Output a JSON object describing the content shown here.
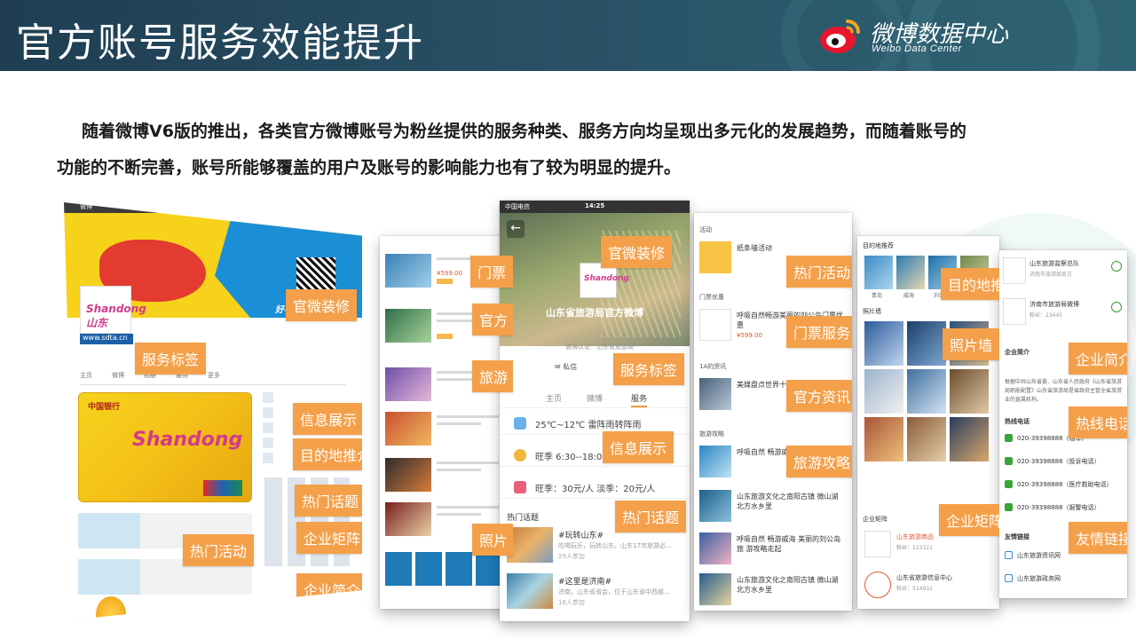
{
  "header": {
    "title": "官方账号服务效能提升",
    "brand_name": "微博数据中心",
    "brand_sub": "Weibo Data Center"
  },
  "intro": {
    "line1": "随着微博V6版的推出，各类官方微博账号为粉丝提供的服务种类、服务方向均呈现出多元化的发展趋势，而随着账号的",
    "line2": "功能的不断完善，账号所能够覆盖的用户及账号的影响能力也有了较为明显的提升。"
  },
  "colors": {
    "tag": "#f4a04a",
    "header": "#1f3e52"
  },
  "panel1": {
    "tags": [
      "官微装修",
      "服务标签",
      "信息展示",
      "目的地推介",
      "热门话题",
      "企业矩阵",
      "企业简介",
      "热门活动"
    ],
    "url": "www.sdta.cn",
    "slogan": "好客山东欢迎您",
    "logo": "Shandong 山东",
    "card_bank": "中国银行",
    "card_name": "Shandong"
  },
  "panel2": {
    "tags": [
      "门票",
      "官方",
      "旅游",
      "照片"
    ],
    "price": "¥599.00"
  },
  "panel3": {
    "carrier": "中国电信",
    "time": "14:25",
    "account_name": "山东省旅游局官方微博",
    "verify": "微博认证：山东省旅游局",
    "msg": "私信",
    "tabs": [
      "主页",
      "微博",
      "服务"
    ],
    "rows": [
      "25℃~12℃ 雷阵雨转阵雨",
      "旺季 6:30--18:00",
      "旺季：30元/人  淡季：20元/人"
    ],
    "topics_title": "热门话题",
    "topics": [
      {
        "title": "#玩转山东#",
        "sub": "吃喝玩乐，玩转山东。山东17市旅游必...",
        "count": "29人参加"
      },
      {
        "title": "#这里是济南#",
        "sub": "济南，山东省省会，位于山东省中西部...",
        "count": "16人参加"
      }
    ],
    "tags": [
      "官微装修",
      "服务标签",
      "信息展示",
      "热门话题"
    ]
  },
  "panel4": {
    "sections": [
      "活动",
      "门票优惠",
      "1A的资讯",
      "旅游攻略"
    ],
    "items": [
      {
        "title": "纸条墙活动",
        "price": ""
      },
      {
        "title": "呼吸自然畅游美丽的刘公岛门票优惠",
        "price": "¥599.00"
      },
      {
        "title": "美媒盘点世界十大文奇迹 中国3地",
        "price": ""
      },
      {
        "title": "呼吸自然 畅游威海旅 游攻略走起",
        "price": ""
      },
      {
        "title": "山东旅游文化之南阳古镇 微山湖北方水乡里",
        "price": ""
      },
      {
        "title": "呼吸自然 畅游威海 美丽的刘公岛旅 游攻略走起",
        "price": ""
      },
      {
        "title": "山东旅游文化之南阳古镇 微山湖北方水乡里",
        "price": ""
      }
    ],
    "tags": [
      "热门活动",
      "门票服务",
      "官方资讯",
      "旅游攻略"
    ]
  },
  "panel5": {
    "head": "目的地推荐",
    "places": [
      "青岛",
      "威海",
      "刘公岛",
      "济南"
    ],
    "photo_head": "照片墙",
    "corp_head": "企业矩阵",
    "corps": [
      {
        "title": "山东旅游商品",
        "sub": "粉丝：123321"
      },
      {
        "title": "山东省旅游信息中心",
        "sub": "粉丝：514932"
      }
    ],
    "tags": [
      "目的地推介",
      "照片墙",
      "企业矩阵"
    ]
  },
  "panel6": {
    "accounts": [
      {
        "title": "山东旅游监察总队",
        "sub": "济南市旅游局官方"
      },
      {
        "title": "济南市旅游局微博",
        "sub": "粉丝：23445"
      }
    ],
    "intro_head": "企业简介",
    "intro_text": "根据中共山东省委、山东省人民政府《山东省旅游局职能配置》山东省旅游局是省政府主管全省旅游业的直属机构。",
    "tel_head": "热线电话",
    "tels": [
      "020-39398888（租车）",
      "020-39398888（投诉电话）",
      "020-39398888（医疗救助电话）",
      "020-39398888（报警电话）"
    ],
    "link_head": "友情链接",
    "links": [
      "山东旅游资讯网",
      "山东旅游政务网"
    ],
    "tags": [
      "企业简介",
      "热线电话",
      "友情链接"
    ]
  }
}
